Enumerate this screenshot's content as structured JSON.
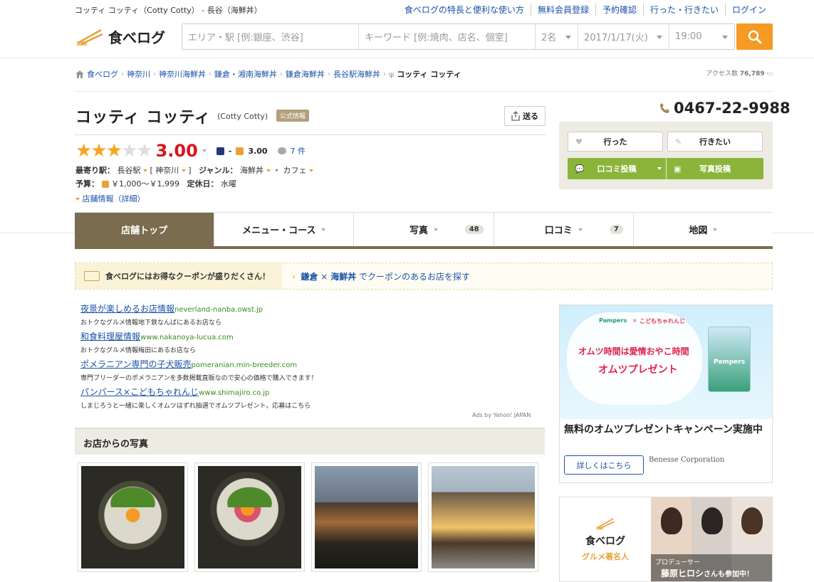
{
  "header": {
    "page_heading": "コッティ コッティ（Cotty Cotty） - 長谷（海鮮丼）",
    "links": [
      "食べログの特長と便利な使い方",
      "無料会員登録",
      "予約確認",
      "行った・行きたい",
      "ログイン"
    ],
    "logo_text": "食べログ",
    "search": {
      "area_placeholder": "エリア・駅 [例:銀座、渋谷]",
      "keyword_placeholder": "キーワード [例:焼肉、店名、個室]",
      "people": "2名",
      "date": "2017/1/17(火)",
      "time": "19:00"
    }
  },
  "breadcrumb": [
    "食べログ",
    "神奈川",
    "神奈川海鮮丼",
    "鎌倉・湘南海鮮丼",
    "鎌倉海鮮丼",
    "長谷駅海鮮丼",
    "コッティ コッティ"
  ],
  "access": {
    "label": "アクセス数",
    "value": "76,789"
  },
  "restaurant": {
    "name": "コッティ コッティ",
    "name_en": "(Cotty Cotty)",
    "official_badge": "公式情報",
    "share_label": "送る",
    "phone": "0467-22-9988",
    "rating": "3.00",
    "stars": 3,
    "night_sep": "-",
    "lunch_rating": "3.00",
    "review_count": "7 件",
    "nearest_label": "最寄り駅：",
    "nearest_station": "長谷駅",
    "prefecture": "神奈川",
    "genre_label": "ジャンル：",
    "genre1": "海鮮丼",
    "genre2": "カフェ",
    "budget_label": "予算：",
    "budget": "￥1,000～￥1,999",
    "holiday_label": "定休日：",
    "holiday": "水曜",
    "detail_link": "店舗情報（詳細）"
  },
  "actions": {
    "went": "行った",
    "want": "行きたい",
    "review": "口コミ投稿",
    "photo": "写真投稿"
  },
  "tabs": [
    {
      "label": "店舗トップ",
      "count": ""
    },
    {
      "label": "メニュー・コース",
      "count": ""
    },
    {
      "label": "写真",
      "count": "48"
    },
    {
      "label": "口コミ",
      "count": "7"
    },
    {
      "label": "地図",
      "count": ""
    }
  ],
  "coupon": {
    "left": "食べログにはお得なクーポンが盛りだくさん！",
    "area": "鎌倉",
    "cross": "×",
    "genre": "海鮮丼",
    "suffix": "でクーポンのあるお店を探す"
  },
  "ads": [
    {
      "title": "夜景が楽しめるお店情報",
      "url": "neverland-nanba.owst.jp",
      "desc": "おトクなグルメ情報地下鉄なんばにあるお店なら"
    },
    {
      "title": "和食料理屋情報",
      "url": "www.nakanoya-lucua.com",
      "desc": "おトクなグルメ情報梅田にあるお店なら"
    },
    {
      "title": "ポメラニアン専門の子犬販売",
      "url": "pomeranian.min-breeder.com",
      "desc": "専門ブリーダーのポメラニアンを多数掲載直販なので安心の価格で購入できます！"
    },
    {
      "title": "パンパース×こどもちゃれんじ",
      "url": "www.shimajiro.co.jp",
      "desc": "しまじろうと一緒に楽しくオムツはずれ抽選でオムツプレゼント。応募はこちら"
    }
  ],
  "ads_by": "Ads by Yahoo! JAPAN",
  "photos_heading": "お店からの写真",
  "side_ad": {
    "brand1": "Pampers",
    "brand_x": "×",
    "brand2": "こどもちゃれんじ",
    "headline": "オムツ時間は愛情おやこ時間",
    "sub": "オムツプレゼント",
    "pack_label": "Pampers",
    "caption": "無料のオムツプレゼントキャンペーン実施中",
    "cta": "詳しくはこちら",
    "sponsor": "Benesse Corporation"
  },
  "side_ad2": {
    "logo": "食べログ",
    "sub": "グルメ著名人",
    "role": "プロデューサー",
    "name": "藤原ヒロシ",
    "suffix": "さんも参加中！"
  },
  "colors": {
    "accent": "#f59a23",
    "tab_active": "#7a6c4e",
    "green": "#8bb53a",
    "score": "#d9141c",
    "link": "#1a52a8"
  }
}
